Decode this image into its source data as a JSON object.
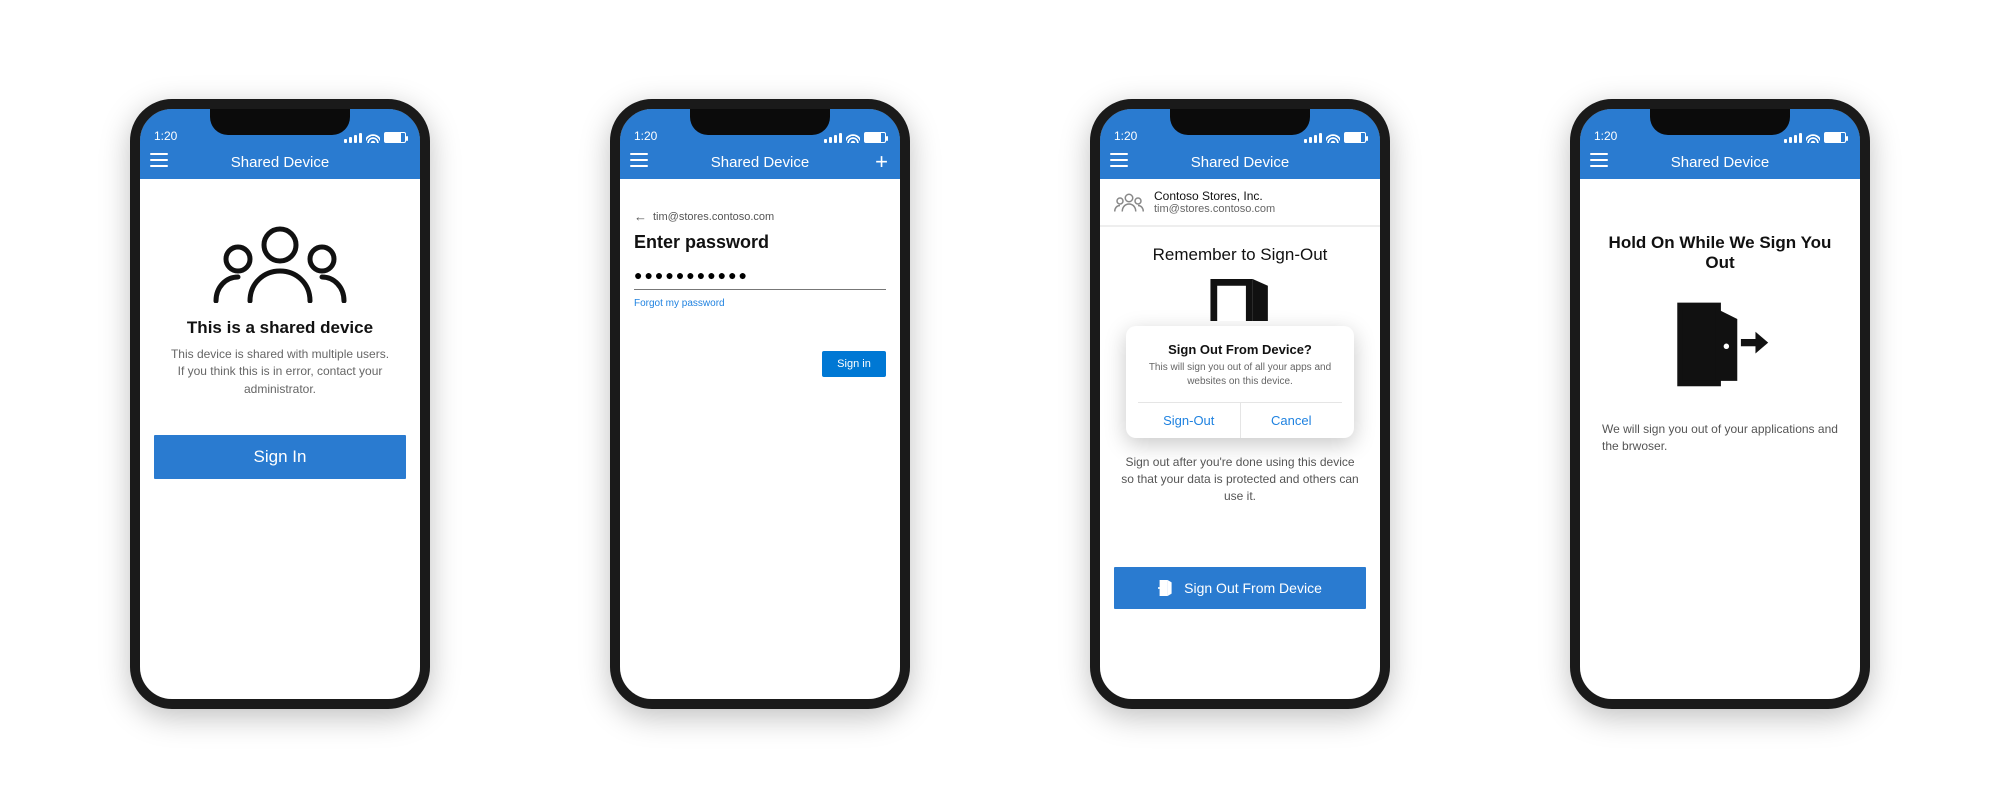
{
  "status": {
    "time": "1:20",
    "time_marker": "↗"
  },
  "nav": {
    "title": "Shared Device"
  },
  "screen1": {
    "title": "This is a shared device",
    "subtitle": "This device is shared with multiple users. If you think this is in error, contact your administrator.",
    "button": "Sign In"
  },
  "screen2": {
    "back_email": "tim@stores.contoso.com",
    "title": "Enter password",
    "password_mask": "●●●●●●●●●●●",
    "forgot": "Forgot my password",
    "signin": "Sign in"
  },
  "screen3": {
    "org_name": "Contoso Stores, Inc.",
    "org_email": "tim@stores.contoso.com",
    "title": "Remember to Sign-Out",
    "modal_title": "Sign Out From Device?",
    "modal_msg": "This will sign you out of all your apps and websites on this device.",
    "modal_ok": "Sign-Out",
    "modal_cancel": "Cancel",
    "note": "Sign out after you're done using this device so that your data is protected and others can use it.",
    "button": "Sign Out From Device"
  },
  "screen4": {
    "title": "Hold On While We Sign You Out",
    "subtitle": "We will sign you out of your applications and the brwoser."
  }
}
